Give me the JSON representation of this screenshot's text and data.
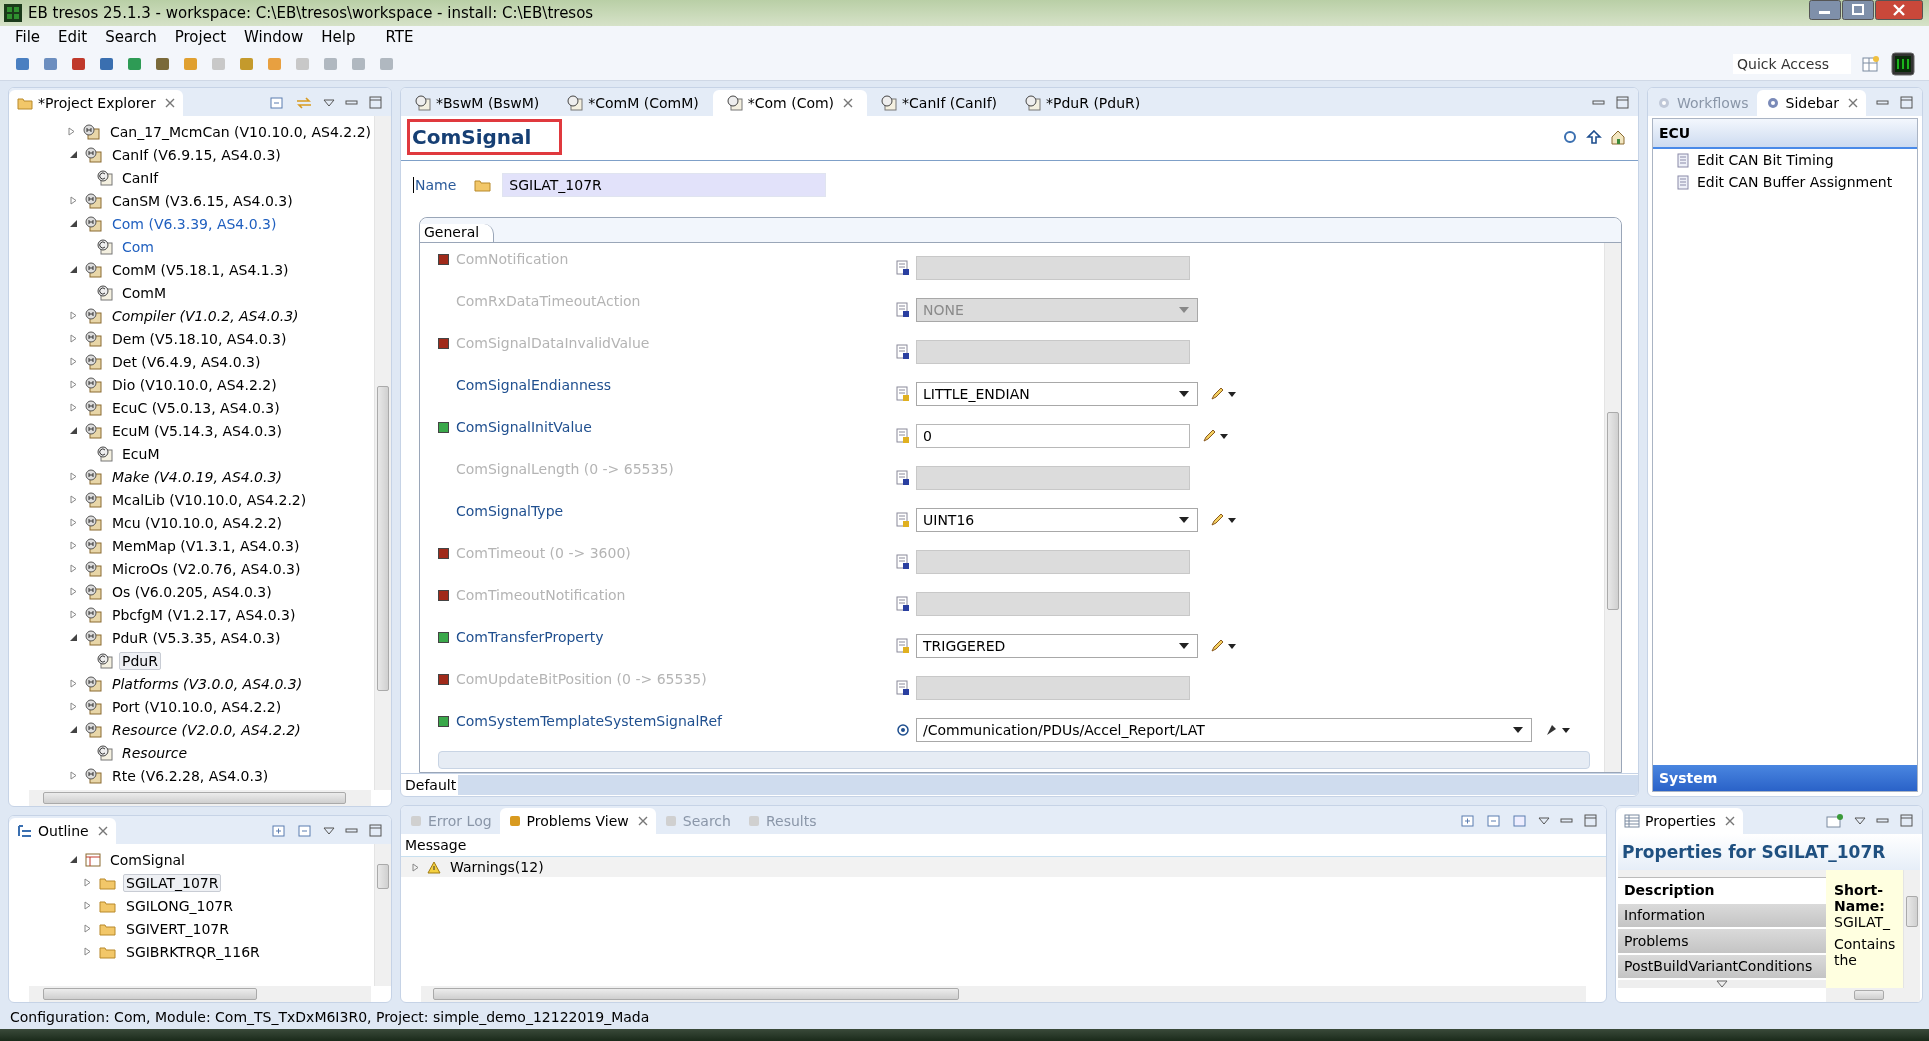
{
  "window": {
    "title": "EB tresos 25.1.3 - workspace: C:\\EB\\tresos\\workspace - install: C:\\EB\\tresos"
  },
  "menu": [
    {
      "label": "File"
    },
    {
      "label": "Edit"
    },
    {
      "label": "Search"
    },
    {
      "label": "Project"
    },
    {
      "label": "Window"
    },
    {
      "label": "Help"
    },
    {
      "label": "RTE"
    }
  ],
  "quick_access": {
    "placeholder": "Quick Access"
  },
  "project_explorer": {
    "title": "*Project Explorer",
    "items": [
      {
        "label": "Can_17_McmCan (V10.10.0, AS4.2.2)",
        "expanded": false,
        "italic": false,
        "active": false,
        "selected": false
      },
      {
        "label": "CanIf (V6.9.15, AS4.0.3)",
        "expanded": true,
        "italic": false,
        "active": false,
        "selected": false,
        "children": [
          {
            "label": "CanIf",
            "italic": false,
            "active": false,
            "selected": false
          }
        ]
      },
      {
        "label": "CanSM (V3.6.15, AS4.0.3)",
        "expanded": false,
        "italic": false,
        "active": false,
        "selected": false
      },
      {
        "label": "Com (V6.3.39, AS4.0.3)",
        "expanded": true,
        "italic": false,
        "active": true,
        "selected": false,
        "children": [
          {
            "label": "Com",
            "italic": false,
            "active": true,
            "selected": false
          }
        ]
      },
      {
        "label": "ComM (V5.18.1, AS4.1.3)",
        "expanded": true,
        "italic": false,
        "active": false,
        "selected": false,
        "children": [
          {
            "label": "ComM",
            "italic": false,
            "active": false,
            "selected": false
          }
        ]
      },
      {
        "label": "Compiler (V1.0.2, AS4.0.3)",
        "expanded": false,
        "italic": true,
        "active": false,
        "selected": false
      },
      {
        "label": "Dem (V5.18.10, AS4.0.3)",
        "expanded": false,
        "italic": false,
        "active": false,
        "selected": false
      },
      {
        "label": "Det (V6.4.9, AS4.0.3)",
        "expanded": false,
        "italic": false,
        "active": false,
        "selected": false
      },
      {
        "label": "Dio (V10.10.0, AS4.2.2)",
        "expanded": false,
        "italic": false,
        "active": false,
        "selected": false
      },
      {
        "label": "EcuC (V5.0.13, AS4.0.3)",
        "expanded": false,
        "italic": false,
        "active": false,
        "selected": false
      },
      {
        "label": "EcuM (V5.14.3, AS4.0.3)",
        "expanded": true,
        "italic": false,
        "active": false,
        "selected": false,
        "children": [
          {
            "label": "EcuM",
            "italic": false,
            "active": false,
            "selected": false
          }
        ]
      },
      {
        "label": "Make (V4.0.19, AS4.0.3)",
        "expanded": false,
        "italic": true,
        "active": false,
        "selected": false
      },
      {
        "label": "McalLib (V10.10.0, AS4.2.2)",
        "expanded": false,
        "italic": false,
        "active": false,
        "selected": false
      },
      {
        "label": "Mcu (V10.10.0, AS4.2.2)",
        "expanded": false,
        "italic": false,
        "active": false,
        "selected": false
      },
      {
        "label": "MemMap (V1.3.1, AS4.0.3)",
        "expanded": false,
        "italic": false,
        "active": false,
        "selected": false
      },
      {
        "label": "MicroOs (V2.0.76, AS4.0.3)",
        "expanded": false,
        "italic": false,
        "active": false,
        "selected": false
      },
      {
        "label": "Os (V6.0.205, AS4.0.3)",
        "expanded": false,
        "italic": false,
        "active": false,
        "selected": false
      },
      {
        "label": "PbcfgM (V1.2.17, AS4.0.3)",
        "expanded": false,
        "italic": false,
        "active": false,
        "selected": false
      },
      {
        "label": "PduR (V5.3.35, AS4.0.3)",
        "expanded": true,
        "italic": false,
        "active": false,
        "selected": false,
        "children": [
          {
            "label": "PduR",
            "italic": false,
            "active": false,
            "selected": true
          }
        ]
      },
      {
        "label": "Platforms (V3.0.0, AS4.0.3)",
        "expanded": false,
        "italic": true,
        "active": false,
        "selected": false
      },
      {
        "label": "Port (V10.10.0, AS4.2.2)",
        "expanded": false,
        "italic": false,
        "active": false,
        "selected": false
      },
      {
        "label": "Resource (V2.0.0, AS4.2.2)",
        "expanded": true,
        "italic": true,
        "active": false,
        "selected": false,
        "children": [
          {
            "label": "Resource",
            "italic": true,
            "active": false,
            "selected": false
          }
        ]
      },
      {
        "label": "Rte (V6.2.28, AS4.0.3)",
        "expanded": false,
        "italic": false,
        "active": false,
        "selected": false
      }
    ]
  },
  "outline": {
    "title": "Outline",
    "items": [
      {
        "label": "ComSignal",
        "expanded": true,
        "selected": false,
        "children": [
          {
            "label": "SGILAT_107R",
            "expanded": false,
            "selected": true
          },
          {
            "label": "SGILONG_107R",
            "expanded": false,
            "selected": false
          },
          {
            "label": "SGIVERT_107R",
            "expanded": false,
            "selected": false
          },
          {
            "label": "SGIBRKTRQR_116R",
            "expanded": false,
            "selected": false
          }
        ]
      }
    ]
  },
  "editor": {
    "tabs": [
      {
        "label": "*BswM (BswM)",
        "selected": false
      },
      {
        "label": "*ComM (ComM)",
        "selected": false
      },
      {
        "label": "*Com (Com)",
        "selected": true
      },
      {
        "label": "*CanIf (CanIf)",
        "selected": false
      },
      {
        "label": "*PduR (PduR)",
        "selected": false
      }
    ],
    "heading": "ComSignal",
    "name_label": "Name",
    "name_value": "SGILAT_107R",
    "section_tab": "General",
    "fields": [
      {
        "label": "ComNotification",
        "optional": true,
        "enabled": false,
        "kind": "text"
      },
      {
        "label": "ComRxDataTimeoutAction",
        "optional": false,
        "enabled": false,
        "kind": "combo",
        "value": "NONE"
      },
      {
        "label": "ComSignalDataInvalidValue",
        "optional": true,
        "enabled": false,
        "kind": "text"
      },
      {
        "label": "ComSignalEndianness",
        "optional": false,
        "enabled": true,
        "kind": "combo",
        "value": "LITTLE_ENDIAN"
      },
      {
        "label": "ComSignalInitValue",
        "optional": true,
        "enabled": true,
        "kind": "text",
        "value": "0"
      },
      {
        "label": "ComSignalLength (0 -> 65535)",
        "optional": false,
        "enabled": false,
        "kind": "text"
      },
      {
        "label": "ComSignalType",
        "optional": false,
        "enabled": true,
        "kind": "combo",
        "value": "UINT16"
      },
      {
        "label": "ComTimeout (0 -> 3600)",
        "optional": true,
        "enabled": false,
        "kind": "text"
      },
      {
        "label": "ComTimeoutNotification",
        "optional": true,
        "enabled": false,
        "kind": "text"
      },
      {
        "label": "ComTransferProperty",
        "optional": true,
        "enabled": true,
        "kind": "combo",
        "value": "TRIGGERED"
      },
      {
        "label": "ComUpdateBitPosition (0 -> 65535)",
        "optional": true,
        "enabled": false,
        "kind": "text"
      },
      {
        "label": "ComSystemTemplateSystemSignalRef",
        "optional": true,
        "enabled": true,
        "kind": "reference",
        "value": "/Communication/PDUs/Accel_Report/LAT"
      }
    ],
    "variant": "Default"
  },
  "bottom": {
    "tabs": [
      {
        "label": "Error Log",
        "selected": false
      },
      {
        "label": "Problems View",
        "selected": true
      },
      {
        "label": "Search",
        "selected": false
      },
      {
        "label": "Results",
        "selected": false
      }
    ],
    "column": "Message",
    "rows": [
      {
        "label": "Warnings(12)",
        "expanded": false
      }
    ]
  },
  "sidebar": {
    "tabs": [
      {
        "label": "Workflows",
        "selected": false
      },
      {
        "label": "Sidebar",
        "selected": true
      }
    ],
    "group": "ECU",
    "items": [
      {
        "label": "Edit CAN Bit Timing"
      },
      {
        "label": "Edit CAN Buffer Assignment"
      }
    ],
    "footer": "System"
  },
  "properties": {
    "tab": "Properties",
    "title": "Properties for SGILAT_107R",
    "categories": [
      {
        "label": "Description",
        "selected": true
      },
      {
        "label": "Information",
        "selected": false
      },
      {
        "label": "Problems",
        "selected": false
      },
      {
        "label": "PostBuildVariantConditions",
        "selected": false
      }
    ],
    "description_heading": "Short-Name:",
    "description_lines": [
      "SGILAT_",
      "Contains",
      "the"
    ]
  },
  "status_bar": "Configuration: Com, Module: Com_TS_TxDxM6I3R0, Project: simple_demo_12122019_Mada"
}
